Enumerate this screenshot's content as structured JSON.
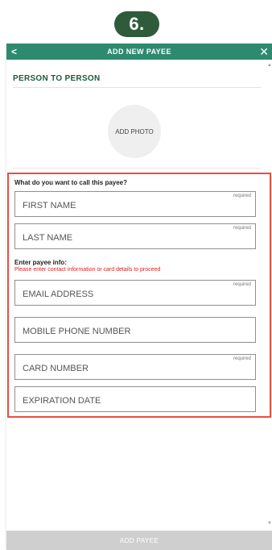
{
  "step_badge": "6.",
  "header": {
    "title": "ADD NEW PAYEE",
    "back_icon": "<",
    "close_icon": "✕"
  },
  "section_title": "PERSON TO PERSON",
  "photo_label": "ADD PHOTO",
  "name_prompt": "What do you want to call this payee?",
  "payee_info": {
    "label": "Enter payee info:",
    "warning": "Please enter contact information or card details to proceed"
  },
  "fields": {
    "first_name": {
      "placeholder": "FIRST NAME",
      "required": "required"
    },
    "last_name": {
      "placeholder": "LAST NAME",
      "required": "required"
    },
    "email": {
      "placeholder": "EMAIL ADDRESS",
      "required": "required"
    },
    "mobile": {
      "placeholder": "MOBILE PHONE NUMBER"
    },
    "card_number": {
      "placeholder": "CARD NUMBER",
      "required": "required"
    },
    "expiration": {
      "placeholder": "EXPIRATION DATE"
    }
  },
  "footer_button": "ADD PAYEE",
  "colors": {
    "header": "#2e8a6f",
    "badge": "#2f5b3a",
    "highlight": "#e8503f",
    "warning": "#e02020",
    "footer_disabled": "#cfcfcf"
  }
}
